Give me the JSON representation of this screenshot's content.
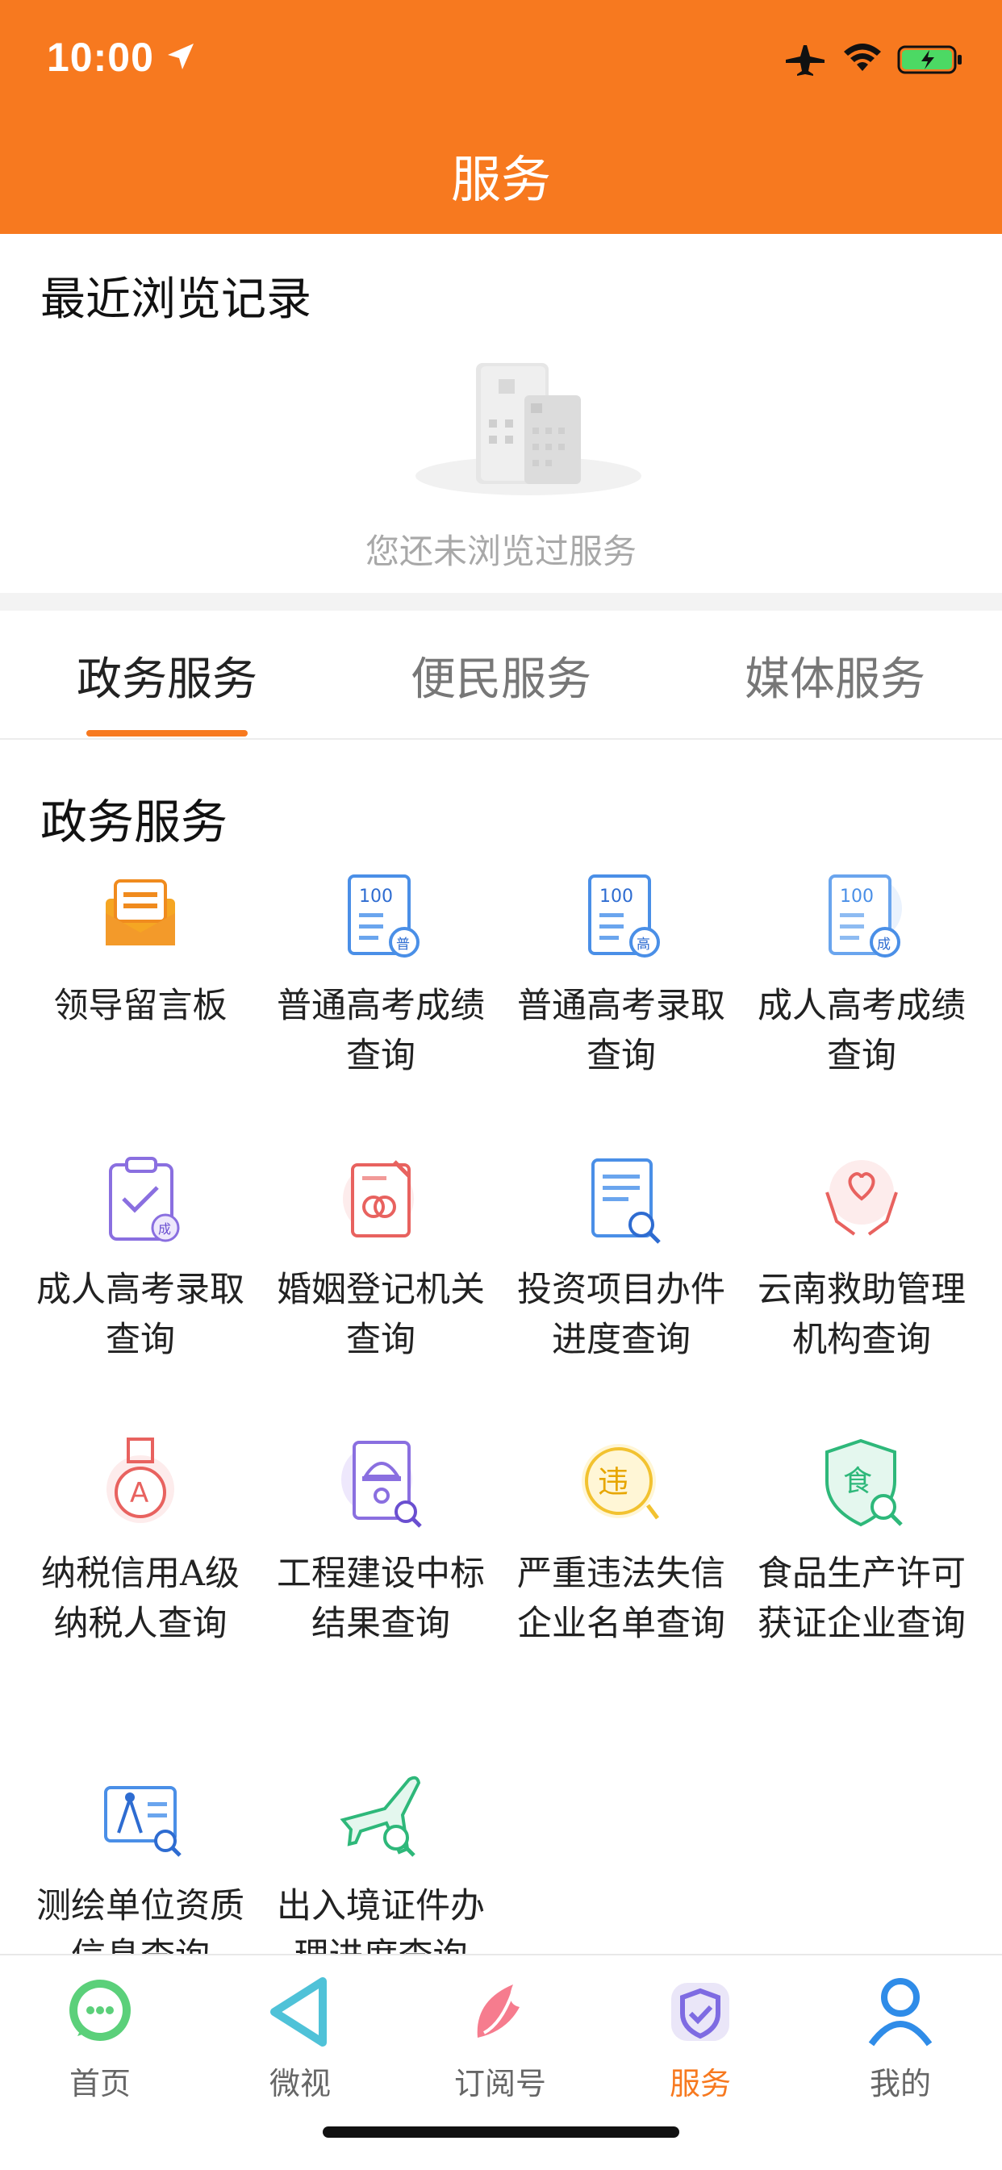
{
  "status_bar": {
    "time": "10:00",
    "icons": [
      "location-arrow-icon",
      "airplane-icon",
      "wifi-icon",
      "battery-charging-icon"
    ]
  },
  "header": {
    "title": "服务"
  },
  "recent": {
    "title": "最近浏览记录",
    "empty_text": "您还未浏览过服务"
  },
  "tabs": [
    {
      "label": "政务服务",
      "active": true
    },
    {
      "label": "便民服务",
      "active": false
    },
    {
      "label": "媒体服务",
      "active": false
    }
  ],
  "section": {
    "title": "政务服务",
    "items": [
      {
        "label": "领导留言板",
        "icon": "mailbox-icon"
      },
      {
        "label": "普通高考成绩查询",
        "icon": "exam-score-icon"
      },
      {
        "label": "普通高考录取查询",
        "icon": "exam-admission-icon"
      },
      {
        "label": "成人高考成绩查询",
        "icon": "adult-exam-score-icon"
      },
      {
        "label": "成人高考录取查询",
        "icon": "clipboard-check-icon"
      },
      {
        "label": "婚姻登记机关查询",
        "icon": "marriage-certificate-icon"
      },
      {
        "label": "投资项目办件进度查询",
        "icon": "document-search-icon"
      },
      {
        "label": "云南救助管理机构查询",
        "icon": "heart-hands-icon"
      },
      {
        "label": "纳税信用A级纳税人查询",
        "icon": "medal-a-icon"
      },
      {
        "label": "工程建设中标结果查询",
        "icon": "construction-helmet-icon"
      },
      {
        "label": "严重违法失信企业名单查询",
        "icon": "violation-icon"
      },
      {
        "label": "食品生产许可获证企业查询",
        "icon": "food-shield-icon"
      },
      {
        "label": "测绘单位资质信息查询",
        "icon": "surveying-icon"
      },
      {
        "label": "出入境证件办理进度查询",
        "icon": "airplane-search-icon"
      }
    ]
  },
  "bottom_nav": [
    {
      "label": "首页",
      "icon": "chat-bubble-icon",
      "active": false
    },
    {
      "label": "微视",
      "icon": "play-triangle-icon",
      "active": false
    },
    {
      "label": "订阅号",
      "icon": "feather-icon",
      "active": false
    },
    {
      "label": "服务",
      "icon": "shield-check-icon",
      "active": true
    },
    {
      "label": "我的",
      "icon": "user-icon",
      "active": false
    }
  ],
  "colors": {
    "accent": "#F7791F"
  }
}
